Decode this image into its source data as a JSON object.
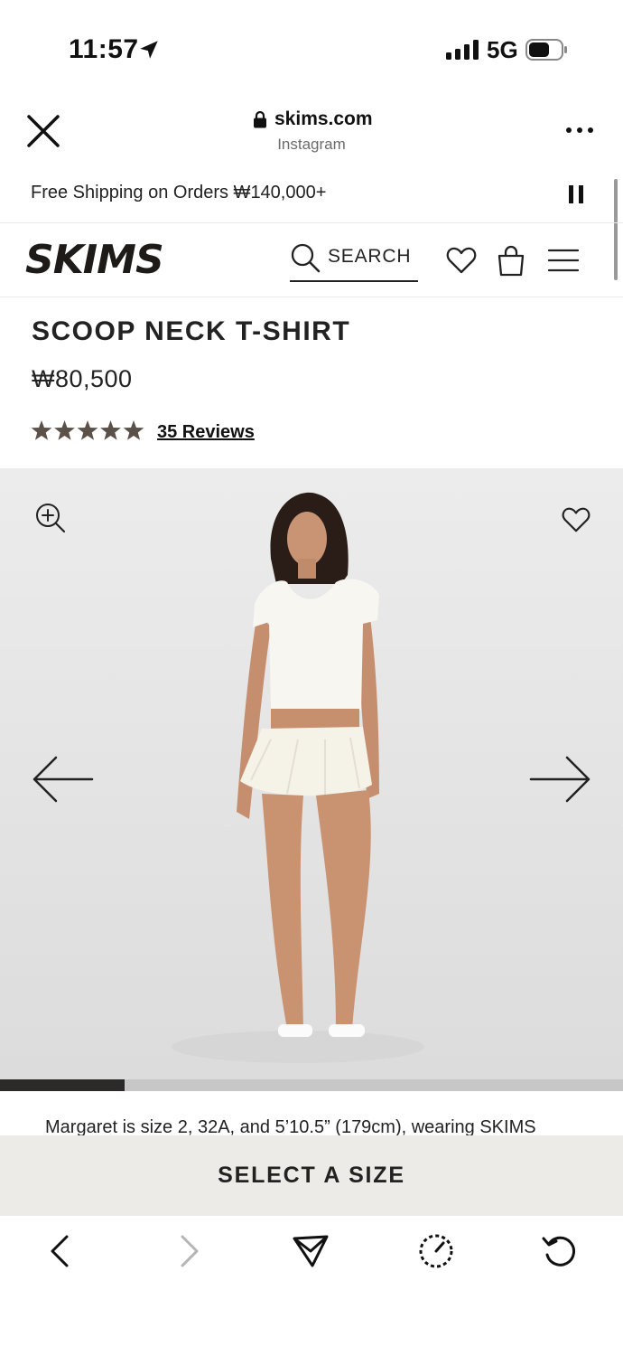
{
  "status_bar": {
    "time": "11:57",
    "network": "5G",
    "location_icon": "location-arrow-icon",
    "signal_icon": "signal-bars-icon",
    "battery_icon": "battery-icon"
  },
  "browser": {
    "domain": "skims.com",
    "source": "Instagram",
    "close_icon": "close-icon",
    "more_icon": "more-dots-icon",
    "lock_icon": "lock-icon"
  },
  "promo": {
    "text": "Free Shipping on Orders ₩140,000+",
    "pause_icon": "pause-icon"
  },
  "nav": {
    "logo": "SKIMS",
    "search_label": "SEARCH",
    "icons": [
      "search-icon",
      "heart-icon",
      "bag-icon",
      "menu-icon"
    ]
  },
  "product": {
    "title": "SCOOP NECK T-SHIRT",
    "price": "₩80,500",
    "rating": 5,
    "rating_max": 5,
    "reviews_label": "35 Reviews",
    "image_alt": "Model wearing a white scoop neck t-shirt and white pleated mini skirt"
  },
  "gallery": {
    "progress": 0.2,
    "zoom_icon": "zoom-in-icon",
    "favorite_icon": "heart-icon",
    "prev_icon": "arrow-left-icon",
    "next_icon": "arrow-right-icon"
  },
  "caption": "Margaret is size 2, 32A, and 5’10.5” (179cm), wearing SKIMS",
  "cta": {
    "select_size_label": "SELECT A SIZE"
  },
  "toolbar": {
    "icons": [
      "back-icon",
      "forward-icon",
      "share-icon",
      "speed-icon",
      "reload-icon"
    ]
  },
  "colors": {
    "star": "#5b5149",
    "cta_bg": "#ecebe7",
    "progress_fill": "#2c2a28",
    "progress_track": "#c7c7c7"
  }
}
